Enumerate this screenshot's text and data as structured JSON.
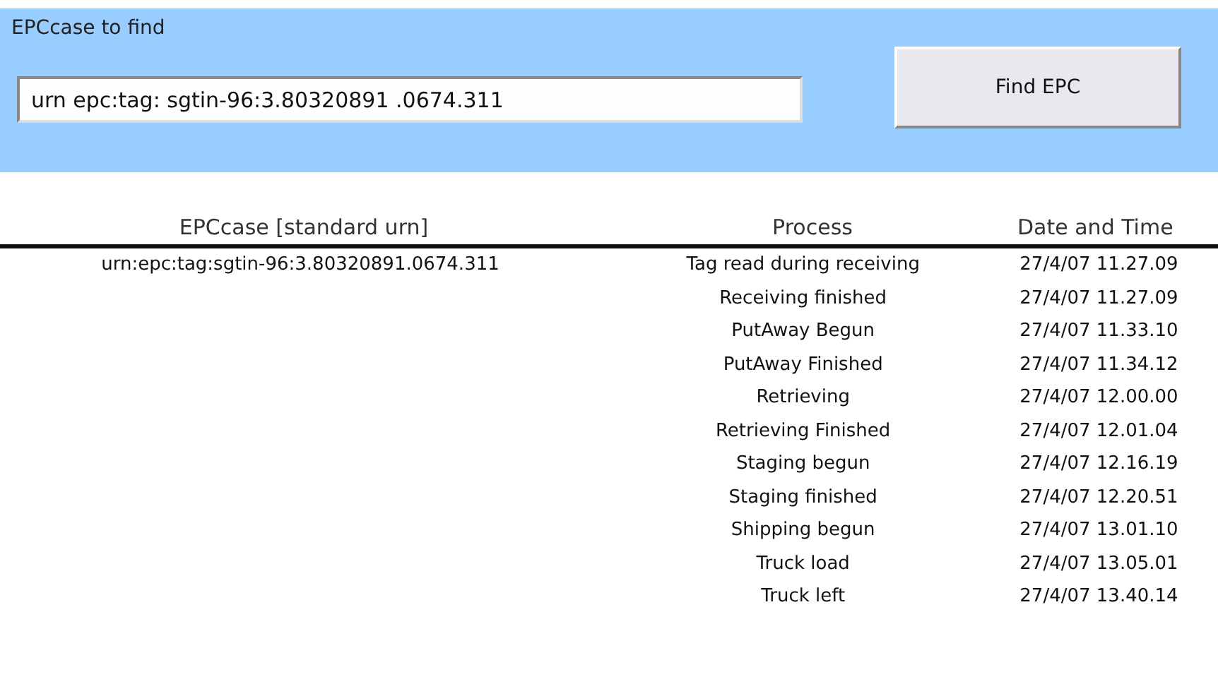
{
  "search": {
    "label": "EPCcase to find",
    "value": "urn epc:tag: sgtin-96:3.80320891 .0674.311",
    "button": "Find EPC"
  },
  "table": {
    "columns": [
      "EPCcase [standard urn]",
      "Process",
      "Date and Time"
    ],
    "rows": [
      {
        "epc": "urn:epc:tag:sgtin-96:3.80320891.0674.311",
        "process": "Tag read during receiving",
        "datetime": "27/4/07 11.27.09"
      },
      {
        "process": "Receiving finished",
        "datetime": "27/4/07 11.27.09"
      },
      {
        "process": "PutAway Begun",
        "datetime": "27/4/07 11.33.10"
      },
      {
        "process": "PutAway Finished",
        "datetime": "27/4/07 11.34.12"
      },
      {
        "process": "Retrieving",
        "datetime": "27/4/07 12.00.00"
      },
      {
        "process": "Retrieving Finished",
        "datetime": "27/4/07 12.01.04"
      },
      {
        "process": "Staging begun",
        "datetime": "27/4/07 12.16.19"
      },
      {
        "process": "Staging finished",
        "datetime": "27/4/07 12.20.51"
      },
      {
        "process": "Shipping begun",
        "datetime": "27/4/07 13.01.10"
      },
      {
        "process": "Truck load",
        "datetime": "27/4/07 13.05.01"
      },
      {
        "process": "Truck left",
        "datetime": "27/4/07 13.40.14"
      }
    ]
  }
}
